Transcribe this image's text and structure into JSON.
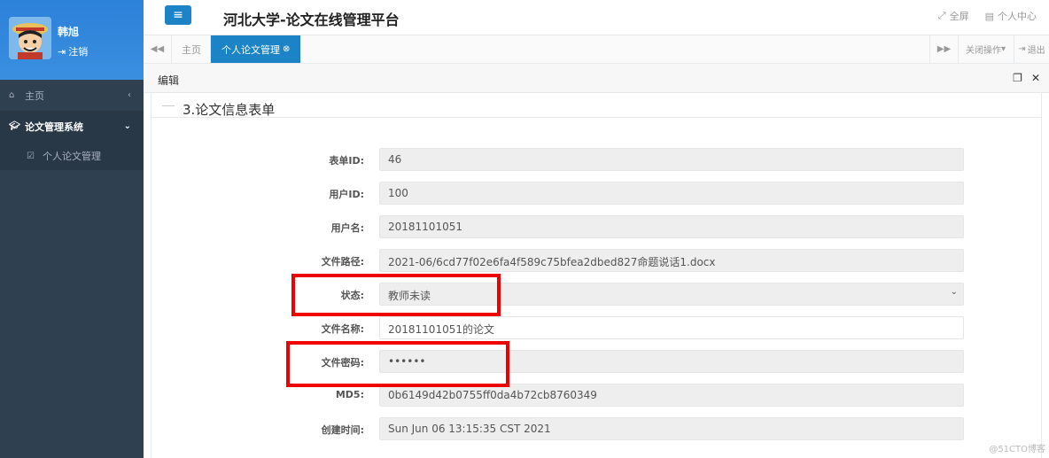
{
  "app": {
    "title": "河北大学-论文在线管理平台"
  },
  "header": {
    "fullscreen": "全屏",
    "personal_center": "个人中心"
  },
  "profile": {
    "name": "韩旭",
    "logout": "注销"
  },
  "sidebar": {
    "items": [
      {
        "label": "主页"
      },
      {
        "label": "论文管理系统"
      },
      {
        "label": "个人论文管理"
      }
    ]
  },
  "tabs": {
    "home": "主页",
    "active": "个人论文管理",
    "close_ops": "关闭操作",
    "exit": "退出"
  },
  "panel": {
    "title": "编辑",
    "section_title": "3.论文信息表单"
  },
  "form": {
    "fields": [
      {
        "label": "表单ID:",
        "value": "46"
      },
      {
        "label": "用户ID:",
        "value": "100"
      },
      {
        "label": "用户名:",
        "value": "20181101051"
      },
      {
        "label": "文件路径:",
        "value": "2021-06/6cd77f02e6fa4f589c75bfea2dbed827命题说话1.docx"
      },
      {
        "label": "状态:",
        "value": "教师未读"
      },
      {
        "label": "文件名称:",
        "value": "20181101051的论文"
      },
      {
        "label": "文件密码:",
        "value": "••••••"
      },
      {
        "label": "MD5:",
        "value": "0b6149d42b0755ff0da4b72cb8760349"
      },
      {
        "label": "创建时间:",
        "value": "Sun Jun 06 13:15:35 CST 2021"
      }
    ]
  },
  "watermark": "@51CTO博客",
  "colors": {
    "sidebar": "#2f4050",
    "accent": "#1c84c6",
    "highlight": "#ee0000"
  }
}
